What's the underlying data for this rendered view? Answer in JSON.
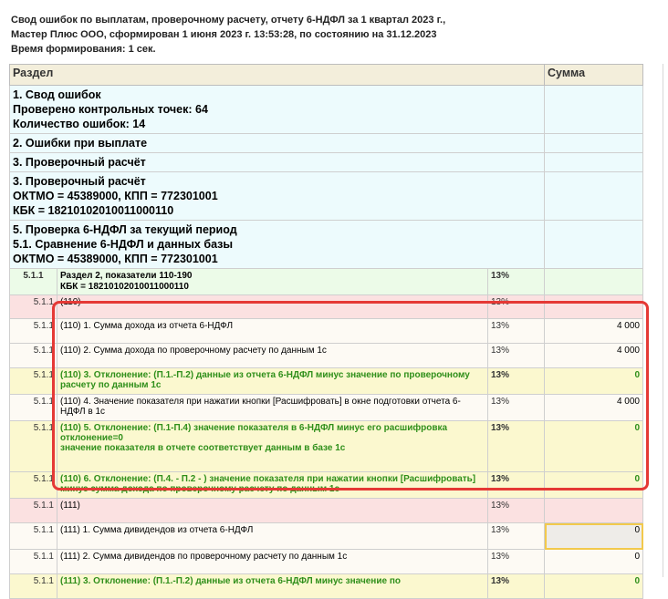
{
  "report": {
    "line1": "Свод ошибок по выплатам, проверочному расчету, отчету 6-НДФЛ  за 1 квартал 2023 г.,",
    "line2": "Мастер Плюс ООО, сформирован 1 июня 2023 г. 13:53:28, по состоянию на 31.12.2023",
    "line3": "Время формирования: 1 сек."
  },
  "columns": {
    "section": "Раздел",
    "sum": "Сумма"
  },
  "sections": {
    "s1": {
      "title": "1. Свод ошибок",
      "checked": "Проверено контрольных точек: 64",
      "errors": "Количество ошибок: 14"
    },
    "s2": {
      "title": "2. Ошибки при выплате"
    },
    "s3a": {
      "title": "3. Проверочный расчёт"
    },
    "s3b": {
      "title": "3. Проверочный расчёт",
      "oktmo": "ОКТМО = 45389000, КПП = 772301001",
      "kbk": "КБК = 18210102010011000110"
    },
    "s5": {
      "title": "5. Проверка 6-НДФЛ за текущий период",
      "sub": "5.1. Сравнение 6-НДФЛ и данных базы",
      "oktmo": "ОКТМО = 45389000, КПП = 772301001"
    }
  },
  "rows": [
    {
      "code": "5.1.1",
      "text1": "Раздел 2, показатели 110-190",
      "text2": "КБК = 18210102010011000110",
      "pct": "13%",
      "sum": ""
    },
    {
      "code": "5.1.1",
      "text": "(110)",
      "pct": "13%",
      "sum": ""
    },
    {
      "code": "5.1.1",
      "text": "(110) 1. Сумма дохода из отчета 6-НДФЛ",
      "pct": "13%",
      "sum": "4 000"
    },
    {
      "code": "5.1.1",
      "text": "(110) 2. Сумма дохода по проверочному расчету по данным 1с",
      "pct": "13%",
      "sum": "4 000"
    },
    {
      "code": "5.1.1",
      "text": "(110) 3. Отклонение: (П.1.-П.2) данные из отчета 6-НДФЛ минус значение по проверочному расчету по данным 1с",
      "pct": "13%",
      "sum": "0"
    },
    {
      "code": "5.1.1",
      "text": "(110) 4. Значение показателя при нажатии кнопки [Расшифровать] в окне подготовки отчета 6-НДФЛ в 1с",
      "pct": "13%",
      "sum": "4 000"
    },
    {
      "code": "5.1.1",
      "text1": "(110) 5. Отклонение: (П.1-П.4) значение показателя в 6-НДФЛ минус его расшифровка",
      "text2": "отклонение=0",
      "text3": "значение показателя в отчете соответствует данным в базе 1с",
      "pct": "13%",
      "sum": "0"
    },
    {
      "code": "5.1.1",
      "text": "(110) 6. Отклонение: (П.4. - П.2 - ) значение показателя при нажатии кнопки [Расшифровать] минус сумма дохода по проверочному расчету по данным 1с",
      "pct": "13%",
      "sum": "0"
    },
    {
      "code": "5.1.1",
      "text": "(111)",
      "pct": "13%",
      "sum": ""
    },
    {
      "code": "5.1.1",
      "text": "(111) 1. Сумма дивидендов из отчета 6-НДФЛ",
      "pct": "13%",
      "sum": "0"
    },
    {
      "code": "5.1.1",
      "text": "(111) 2. Сумма дивидендов по проверочному расчету по данным 1с",
      "pct": "13%",
      "sum": "0"
    },
    {
      "code": "5.1.1",
      "text": "(111) 3. Отклонение: (П.1.-П.2) данные из отчета 6-НДФЛ минус значение по",
      "pct": "13%",
      "sum": "0"
    }
  ]
}
